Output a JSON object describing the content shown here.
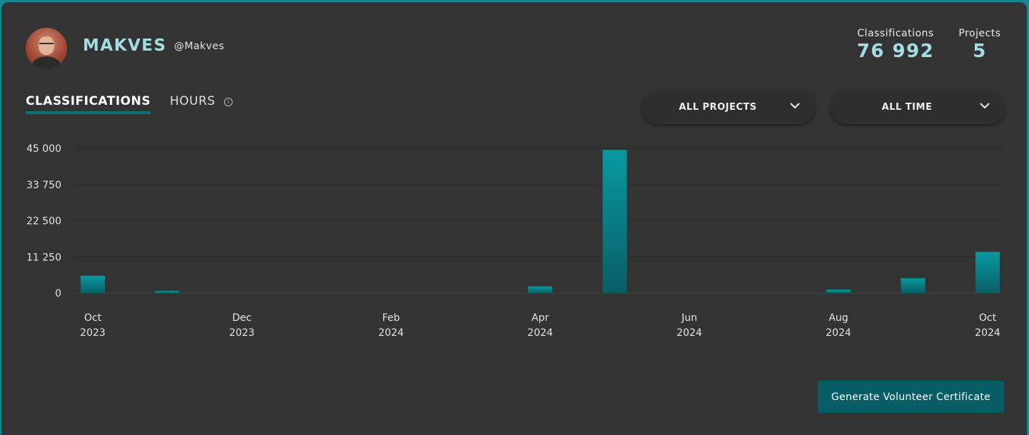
{
  "user": {
    "display_name": "MAKVES",
    "handle": "@Makves"
  },
  "stats": {
    "classifications_label": "Classifications",
    "classifications_value": "76 992",
    "projects_label": "Projects",
    "projects_value": "5"
  },
  "tabs": {
    "classifications": "CLASSIFICATIONS",
    "hours": "HOURS",
    "active": "classifications"
  },
  "filters": {
    "projects": "ALL PROJECTS",
    "time": "ALL TIME"
  },
  "colors": {
    "accent": "#a3dde4",
    "bar_top": "#079aa1",
    "bar_bottom": "#0a5d66",
    "button": "#075d66"
  },
  "chart_data": {
    "type": "bar",
    "categories": [
      "Oct 2023",
      "Nov 2023",
      "Dec 2023",
      "Jan 2024",
      "Feb 2024",
      "Mar 2024",
      "Apr 2024",
      "May 2024",
      "Jun 2024",
      "Jul 2024",
      "Aug 2024",
      "Sep 2024",
      "Oct 2024"
    ],
    "values": [
      5400,
      700,
      0,
      0,
      0,
      0,
      2100,
      44500,
      0,
      0,
      1100,
      4600,
      12800
    ],
    "ylim": [
      0,
      45000
    ],
    "yticks": [
      "45 000",
      "33 750",
      "22 500",
      "11 250",
      "0"
    ],
    "ytick_values": [
      45000,
      33750,
      22500,
      11250,
      0
    ],
    "xticks": [
      {
        "index": 0,
        "month": "Oct",
        "year": "2023"
      },
      {
        "index": 2,
        "month": "Dec",
        "year": "2023"
      },
      {
        "index": 4,
        "month": "Feb",
        "year": "2024"
      },
      {
        "index": 6,
        "month": "Apr",
        "year": "2024"
      },
      {
        "index": 8,
        "month": "Jun",
        "year": "2024"
      },
      {
        "index": 10,
        "month": "Aug",
        "year": "2024"
      },
      {
        "index": 12,
        "month": "Oct",
        "year": "2024"
      }
    ],
    "grid": true
  },
  "certificate_button": "Generate Volunteer Certificate"
}
